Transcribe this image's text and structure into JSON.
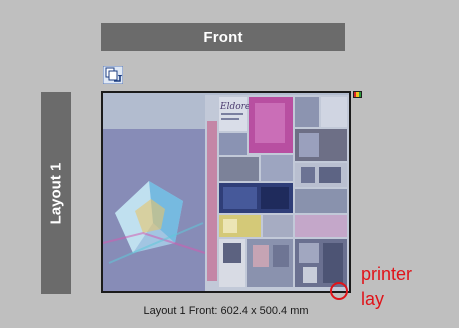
{
  "imposition_view": {
    "side_tab": "Front",
    "layout_tab": "Layout 1",
    "caption": "Layout 1 Front: 602.4 x 500.4 mm",
    "preview_masthead": "Eldoret",
    "annotation": {
      "line1": "printer",
      "line2": "lay"
    }
  },
  "icons": {
    "flip": "flip-sheet-icon",
    "color_bar": "color-bar-icon",
    "marker": "printer-lay-marker"
  },
  "colors": {
    "background": "#bfbfbf",
    "tab": "#6b6b6b",
    "tab_text": "#ffffff",
    "annotation": "#e0141a",
    "sheet_tint": "#a9b3c9"
  }
}
